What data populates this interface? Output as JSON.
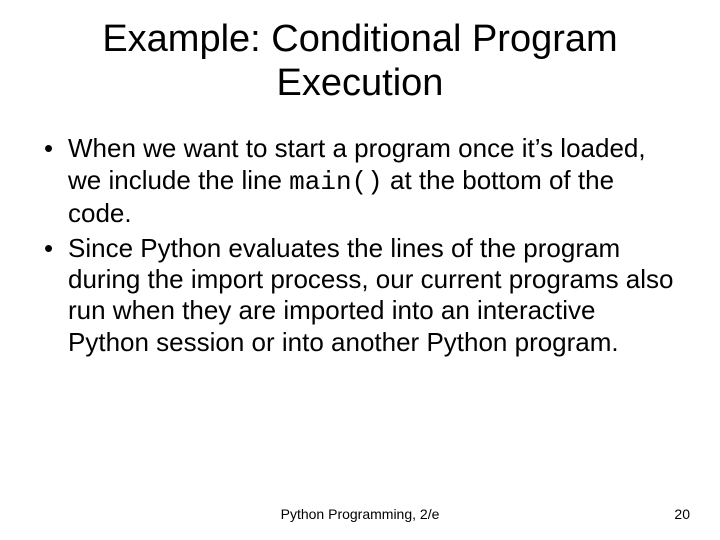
{
  "title": "Example: Conditional Program Execution",
  "bullets": [
    {
      "pre": "When we want to start a program once it’s loaded, we include the line ",
      "code": "main()",
      "post": " at the bottom of the code."
    },
    {
      "pre": "Since Python evaluates the lines of the program during the import process, our current programs also run when they are imported into an interactive Python session or into another Python program.",
      "code": "",
      "post": ""
    }
  ],
  "footer": {
    "center": "Python Programming, 2/e",
    "page": "20"
  }
}
